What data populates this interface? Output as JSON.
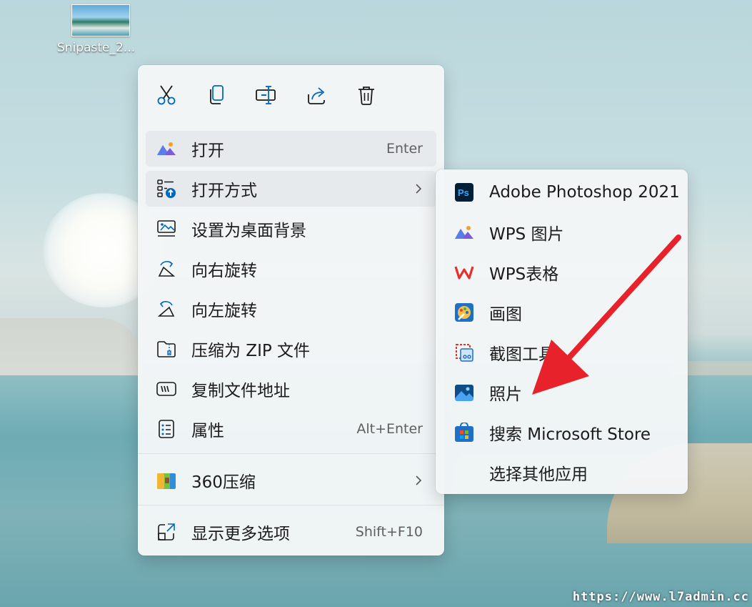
{
  "desktop": {
    "icon_label": "Snipaste_2..."
  },
  "context_menu": {
    "toolbar": [
      {
        "name": "cut",
        "icon": "scissors-icon"
      },
      {
        "name": "copy",
        "icon": "copy-icon"
      },
      {
        "name": "rename",
        "icon": "rename-icon"
      },
      {
        "name": "share",
        "icon": "share-icon"
      },
      {
        "name": "delete",
        "icon": "trash-icon"
      }
    ],
    "items": [
      {
        "label": "打开",
        "shortcut": "Enter",
        "icon": "photos-app-icon"
      },
      {
        "label": "打开方式",
        "shortcut": "",
        "icon": "open-with-icon",
        "has_submenu": true
      },
      {
        "label": "设置为桌面背景",
        "shortcut": "",
        "icon": "wallpaper-icon"
      },
      {
        "label": "向右旋转",
        "shortcut": "",
        "icon": "rotate-right-icon"
      },
      {
        "label": "向左旋转",
        "shortcut": "",
        "icon": "rotate-left-icon"
      },
      {
        "label": "压缩为 ZIP 文件",
        "shortcut": "",
        "icon": "zip-folder-icon"
      },
      {
        "label": "复制文件地址",
        "shortcut": "",
        "icon": "copy-path-icon"
      },
      {
        "label": "属性",
        "shortcut": "Alt+Enter",
        "icon": "properties-icon"
      }
    ],
    "extra_item": {
      "label": "360压缩",
      "icon": "archive-360-icon",
      "has_submenu": true
    },
    "more_item": {
      "label": "显示更多选项",
      "shortcut": "Shift+F10",
      "icon": "show-more-icon"
    }
  },
  "open_with_menu": {
    "items": [
      {
        "label": "Adobe Photoshop 2021",
        "icon": "photoshop-icon"
      },
      {
        "label": "WPS 图片",
        "icon": "wps-picture-icon"
      },
      {
        "label": "WPS表格",
        "icon": "wps-sheet-icon"
      },
      {
        "label": "画图",
        "icon": "paint-icon"
      },
      {
        "label": "截图工具",
        "icon": "snipping-tool-icon"
      },
      {
        "label": "照片",
        "icon": "photos-icon"
      },
      {
        "label": "搜索 Microsoft Store",
        "icon": "store-icon"
      },
      {
        "label": "选择其他应用",
        "icon": ""
      }
    ]
  },
  "colors": {
    "accent": "#0067c0",
    "annotation_arrow": "#e8222b"
  },
  "watermark": "https://www.l7admin.cc"
}
